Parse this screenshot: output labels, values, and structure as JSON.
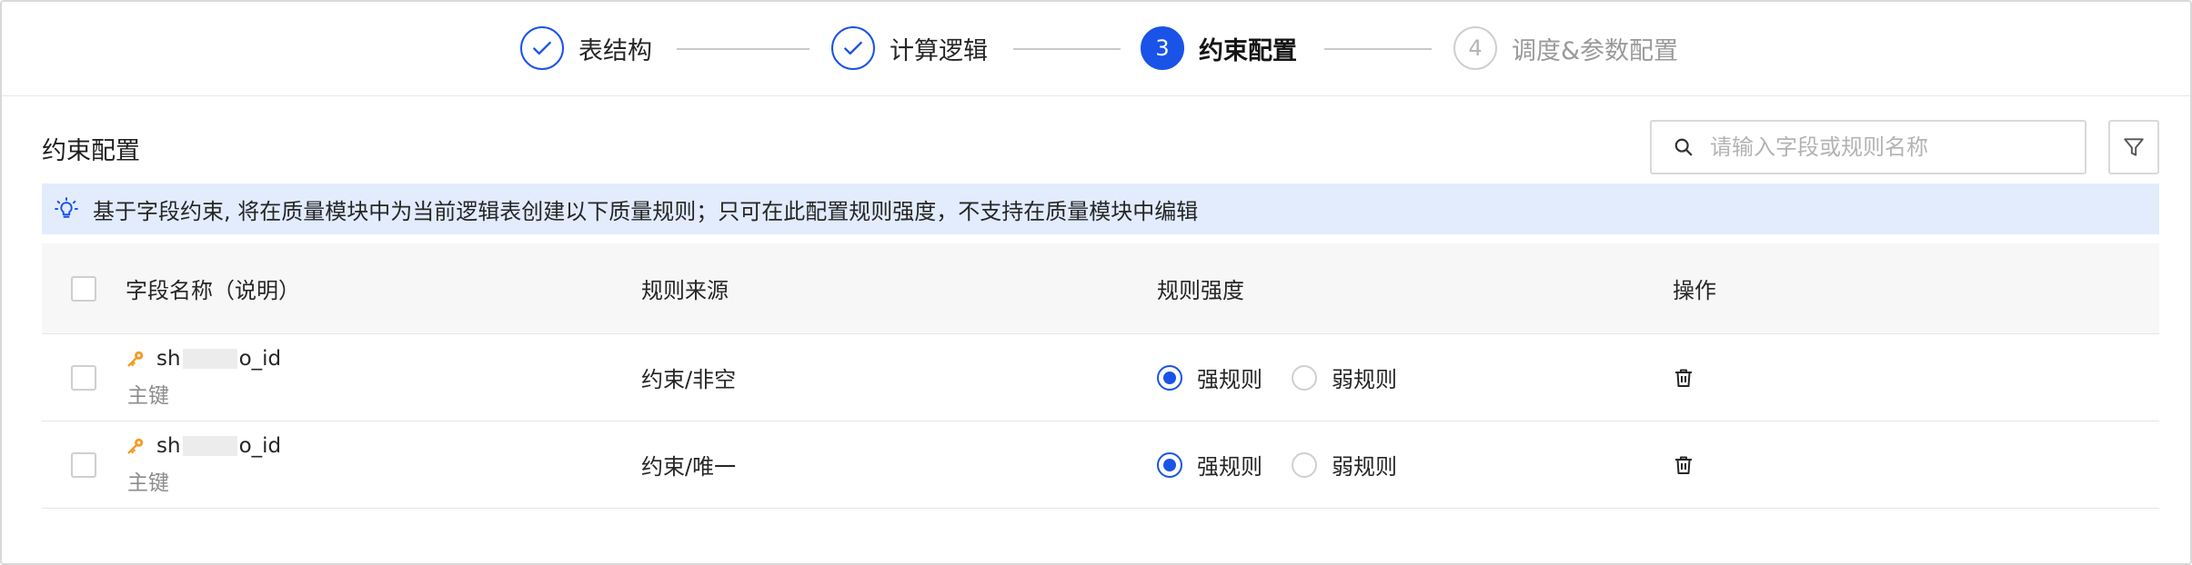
{
  "steps": [
    {
      "index": "1",
      "label": "表结构",
      "state": "done"
    },
    {
      "index": "2",
      "label": "计算逻辑",
      "state": "done"
    },
    {
      "index": "3",
      "label": "约束配置",
      "state": "active"
    },
    {
      "index": "4",
      "label": "调度&参数配置",
      "state": "wait"
    }
  ],
  "section": {
    "title": "约束配置"
  },
  "search": {
    "placeholder": "请输入字段或规则名称",
    "value": ""
  },
  "tip": {
    "text": "基于字段约束, 将在质量模块中为当前逻辑表创建以下质量规则；只可在此配置规则强度，不支持在质量模块中编辑"
  },
  "table": {
    "headers": {
      "field": "字段名称（说明）",
      "source": "规则来源",
      "strength": "规则强度",
      "action": "操作"
    },
    "rows": [
      {
        "field_prefix": "sh",
        "field_suffix": "o_id",
        "field_desc": "主键",
        "source": "约束/非空",
        "strong_label": "强规则",
        "weak_label": "弱规则",
        "strength": "strong"
      },
      {
        "field_prefix": "sh",
        "field_suffix": "o_id",
        "field_desc": "主键",
        "source": "约束/唯一",
        "strong_label": "强规则",
        "weak_label": "弱规则",
        "strength": "strong"
      }
    ]
  },
  "colors": {
    "accent": "#1a53e8",
    "tip_bg": "#e2ecfd",
    "key_icon": "#f59a23"
  },
  "icons": [
    "check-icon",
    "search-icon",
    "filter-icon",
    "lightbulb-icon",
    "key-icon",
    "trash-icon"
  ]
}
